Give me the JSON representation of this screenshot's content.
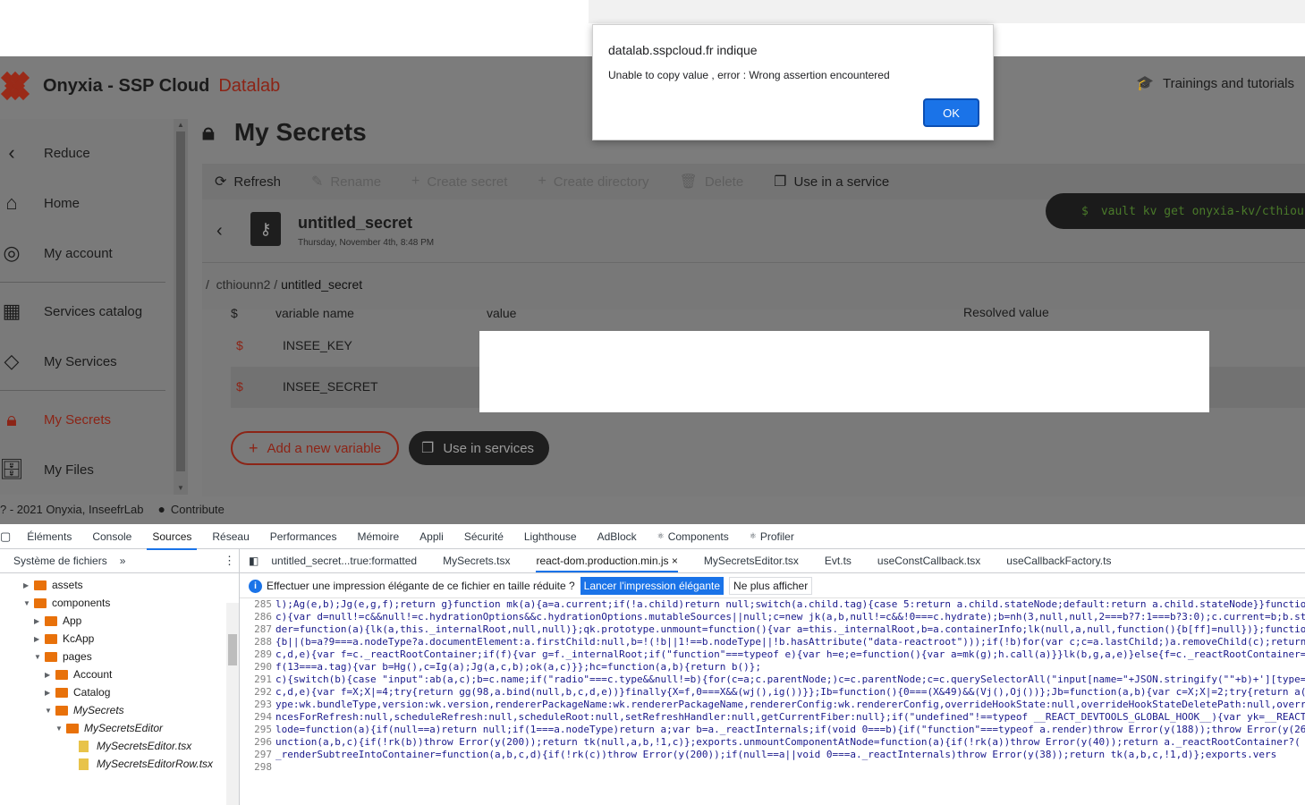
{
  "app": {
    "brand_title": "Onyxia - SSP Cloud",
    "brand_accent": "Datalab",
    "trainings": "Trainings and tutorials"
  },
  "sidebar": {
    "items": [
      {
        "label": "Reduce",
        "icon": "chevron-left-icon"
      },
      {
        "label": "Home",
        "icon": "home-icon"
      },
      {
        "label": "My account",
        "icon": "account-icon"
      },
      {
        "label": "Services catalog",
        "icon": "catalog-icon"
      },
      {
        "label": "My Services",
        "icon": "layers-icon"
      },
      {
        "label": "My Secrets",
        "icon": "lock-icon",
        "active": true
      },
      {
        "label": "My Files",
        "icon": "files-icon"
      }
    ]
  },
  "page": {
    "title": "My Secrets"
  },
  "toolbar": {
    "refresh": "Refresh",
    "rename": "Rename",
    "create_secret": "Create secret",
    "create_directory": "Create directory",
    "delete": "Delete",
    "use_in_service": "Use in a service"
  },
  "secret": {
    "name": "untitled_secret",
    "date": "Thursday, November 4th, 8:48 PM",
    "command": "vault kv get onyxia-kv/cthiou",
    "command_prefix": "$"
  },
  "breadcrumb": {
    "sep": "/",
    "parent": "cthiounn2",
    "current": "untitled_secret"
  },
  "table": {
    "headers": {
      "dollar": "$",
      "name": "variable name",
      "value": "value",
      "resolved": "Resolved value"
    },
    "rows": [
      {
        "dollar": "$",
        "name": "INSEE_KEY"
      },
      {
        "dollar": "$",
        "name": "INSEE_SECRET"
      }
    ]
  },
  "actions": {
    "add_variable": "Add a new variable",
    "use_in_services": "Use in services"
  },
  "footer": {
    "copyright": "? - 2021 Onyxia, InseefrLab",
    "contribute": "Contribute"
  },
  "dialog": {
    "host": "datalab.sspcloud.fr indique",
    "message": "Unable to copy value , error : Wrong assertion encountered",
    "ok": "OK"
  },
  "devtools": {
    "tabs": [
      "Éléments",
      "Console",
      "Sources",
      "Réseau",
      "Performances",
      "Mémoire",
      "Appli",
      "Sécurité",
      "Lighthouse",
      "AdBlock",
      "Components",
      "Profiler"
    ],
    "active_tab": "Sources",
    "left_head": "Système de fichiers",
    "left_more": "»",
    "tree": [
      {
        "label": "assets",
        "type": "folder",
        "level": 1,
        "open": false
      },
      {
        "label": "components",
        "type": "folder",
        "level": 1,
        "open": true
      },
      {
        "label": "App",
        "type": "folder",
        "level": 2,
        "open": false
      },
      {
        "label": "KcApp",
        "type": "folder",
        "level": 2,
        "open": false
      },
      {
        "label": "pages",
        "type": "folder",
        "level": 2,
        "open": true
      },
      {
        "label": "Account",
        "type": "folder",
        "level": 3,
        "open": false
      },
      {
        "label": "Catalog",
        "type": "folder",
        "level": 3,
        "open": false
      },
      {
        "label": "MySecrets",
        "type": "folder",
        "level": 3,
        "open": true
      },
      {
        "label": "MySecretsEditor",
        "type": "folder",
        "level": 4,
        "open": true
      },
      {
        "label": "MySecretsEditor.tsx",
        "type": "file",
        "level": 5
      },
      {
        "label": "MySecretsEditorRow.tsx",
        "type": "file",
        "level": 5
      }
    ],
    "file_tabs": [
      "untitled_secret...true:formatted",
      "MySecrets.tsx",
      "react-dom.production.min.js ×",
      "MySecretsEditor.tsx",
      "Evt.ts",
      "useConstCallback.tsx",
      "useCallbackFactory.ts"
    ],
    "active_file_tab": "react-dom.production.min.js ×",
    "infobar": {
      "text": "Effectuer une impression élégante de ce fichier en taille réduite ?",
      "primary": "Lancer l'impression élégante",
      "secondary": "Ne plus afficher"
    },
    "code": [
      {
        "ln": "285",
        "text": "l);Ag(e,b);Jg(e,g,f);return g}function mk(a){a=a.current;if(!a.child)return null;switch(a.child.tag){case 5:return a.child.stateNode;default:return a.child.stateNode}}function"
      },
      {
        "ln": "286",
        "text": "c){var d=null!=c&&null!=c.hydrationOptions&&c.hydrationOptions.mutableSources||null;c=new jk(a,b,null!=c&&!0===c.hydrate);b=nh(3,null,null,2===b?7:1===b?3:0);c.current=b;b.st"
      },
      {
        "ln": "287",
        "text": "der=function(a){lk(a,this._internalRoot,null,null)};qk.prototype.unmount=function(){var a=this._internalRoot,b=a.containerInfo;lk(null,a,null,function(){b[ff]=null})};functio"
      },
      {
        "ln": "288",
        "text": "{b||(b=a?9===a.nodeType?a.documentElement:a.firstChild:null,b=!(!b||1!==b.nodeType||!b.hasAttribute(\"data-reactroot\")));if(!b)for(var c;c=a.lastChild;)a.removeChild(c);return"
      },
      {
        "ln": "289",
        "text": "c,d,e){var f=c._reactRootContainer;if(f){var g=f._internalRoot;if(\"function\"===typeof e){var h=e;e=function(){var a=mk(g);h.call(a)}}lk(b,g,a,e)}else{f=c._reactRootContainer="
      },
      {
        "ln": "290",
        "text": "f(13===a.tag){var b=Hg(),c=Ig(a);Jg(a,c,b);ok(a,c)}};hc=function(a,b){return b()};"
      },
      {
        "ln": "291",
        "text": "c){switch(b){case \"input\":ab(a,c);b=c.name;if(\"radio\"===c.type&&null!=b){for(c=a;c.parentNode;)c=c.parentNode;c=c.querySelectorAll(\"input[name=\"+JSON.stringify(\"\"+b)+'][type="
      },
      {
        "ln": "292",
        "text": "c,d,e){var f=X;X|=4;try{return gg(98,a.bind(null,b,c,d,e))}finally{X=f,0===X&&(wj(),ig())}};Ib=function(){0===(X&49)&&(Vj(),Oj())};Jb=function(a,b){var c=X;X|=2;try{return a("
      },
      {
        "ln": "293",
        "text": "ype:wk.bundleType,version:wk.version,rendererPackageName:wk.rendererPackageName,rendererConfig:wk.rendererConfig,overrideHookState:null,overrideHookStateDeletePath:null,overri"
      },
      {
        "ln": "294",
        "text": "ncesForRefresh:null,scheduleRefresh:null,scheduleRoot:null,setRefreshHandler:null,getCurrentFiber:null};if(\"undefined\"!==typeof __REACT_DEVTOOLS_GLOBAL_HOOK__){var yk=__REACT"
      },
      {
        "ln": "295",
        "text": "lode=function(a){if(null==a)return null;if(1===a.nodeType)return a;var b=a._reactInternals;if(void 0===b){if(\"function\"===typeof a.render)throw Error(y(188));throw Error(y(268"
      },
      {
        "ln": "296",
        "text": "unction(a,b,c){if(!rk(b))throw Error(y(200));return tk(null,a,b,!1,c)};exports.unmountComponentAtNode=function(a){if(!rk(a))throw Error(y(40));return a._reactRootContainer?("
      },
      {
        "ln": "297",
        "text": "_renderSubtreeIntoContainer=function(a,b,c,d){if(!rk(c))throw Error(y(200));if(null==a||void 0===a._reactInternals)throw Error(y(38));return tk(a,b,c,!1,d)};exports.vers"
      },
      {
        "ln": "298",
        "text": ""
      }
    ]
  },
  "colors": {
    "accent": "#8c2416",
    "devtools_blue": "#1a73e8"
  }
}
